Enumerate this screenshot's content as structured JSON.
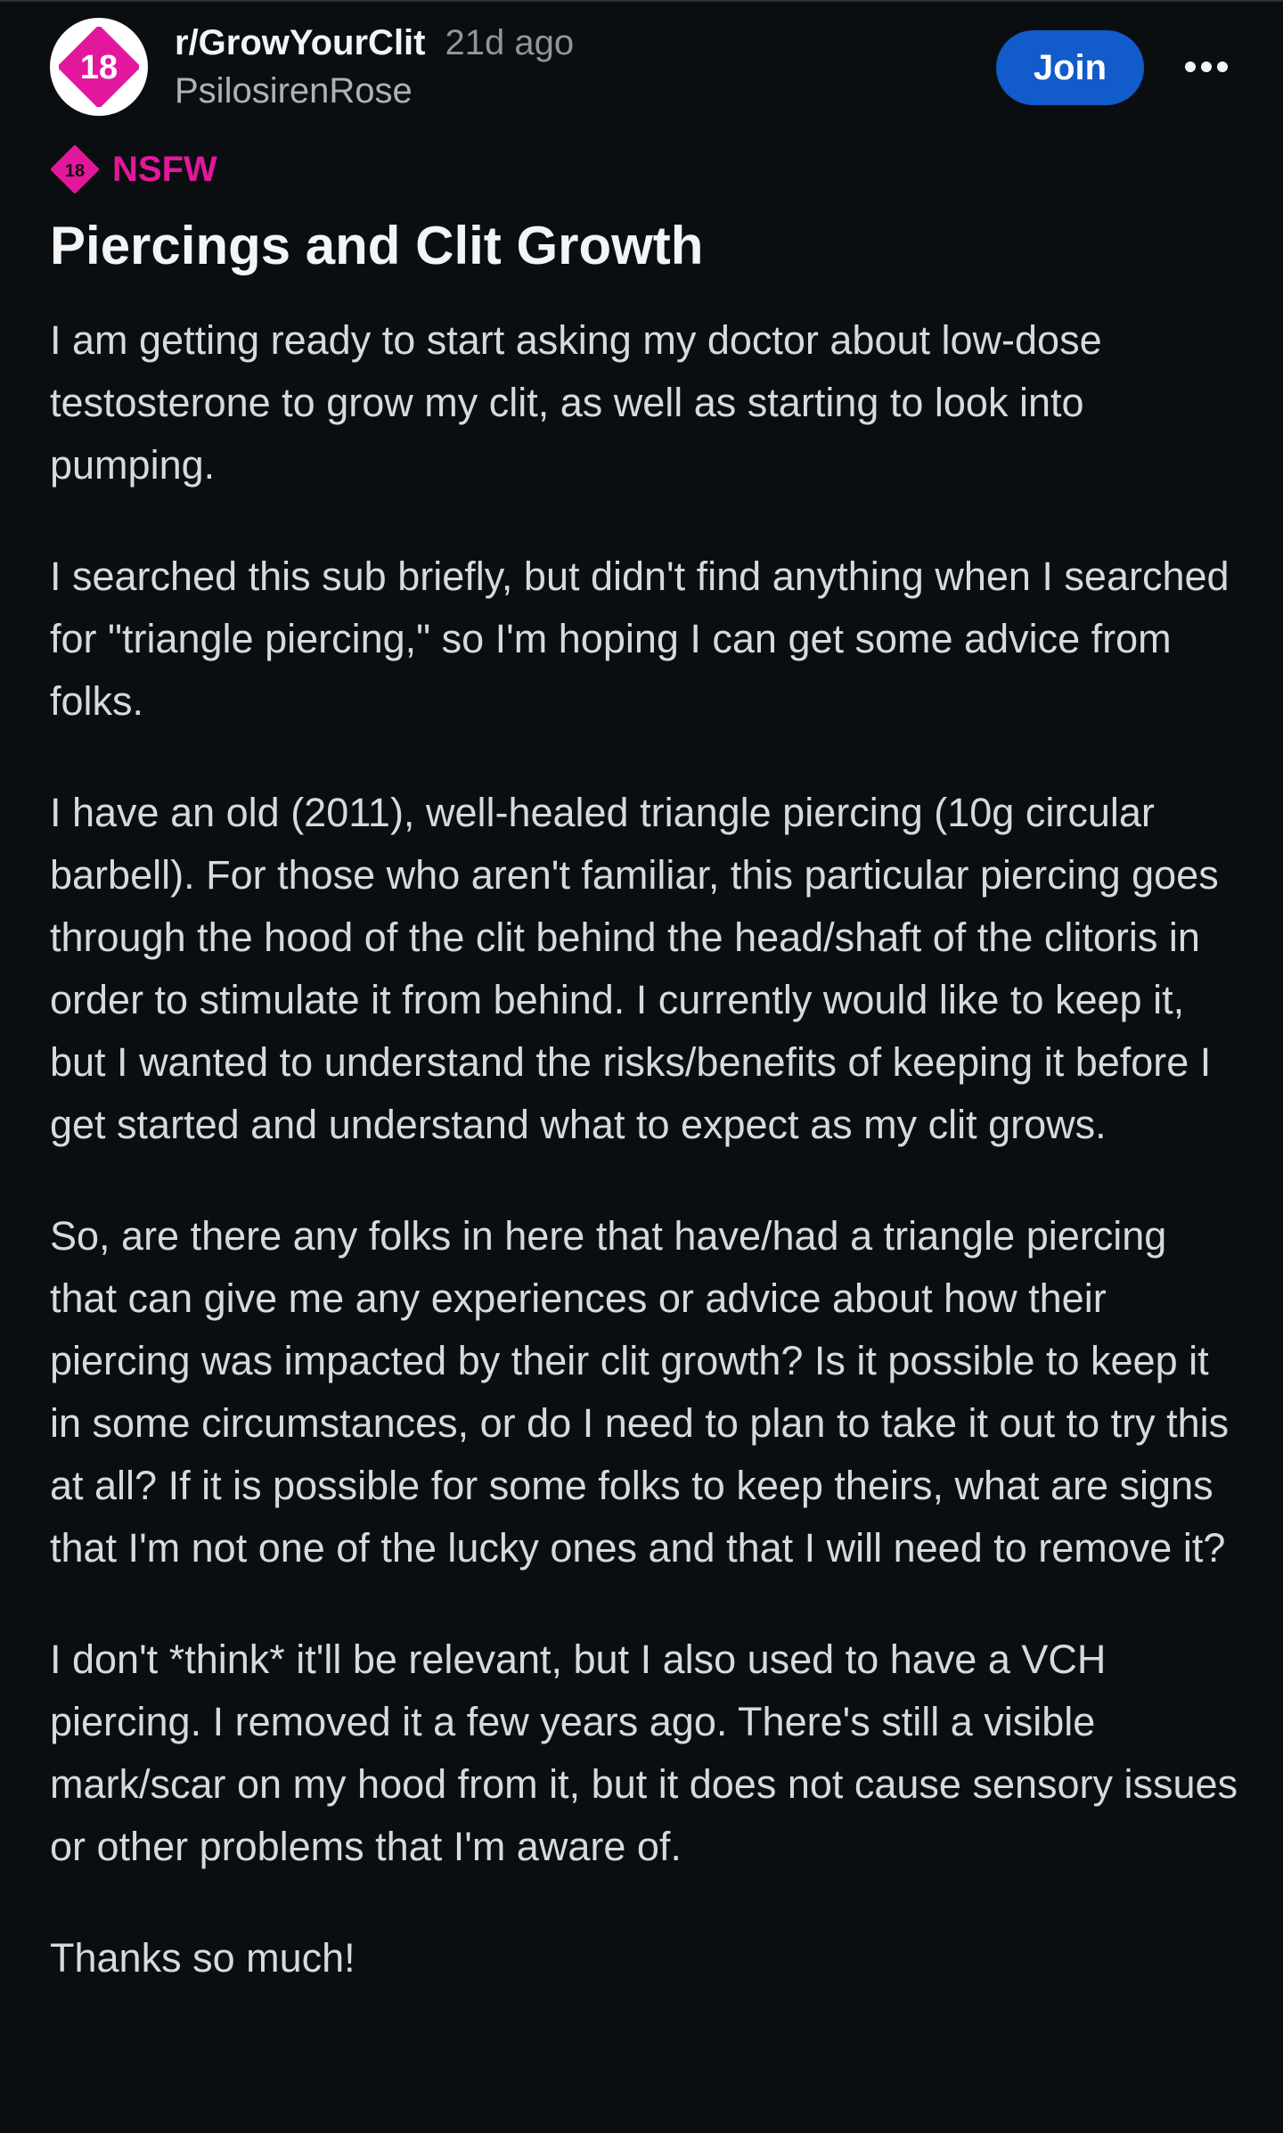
{
  "post": {
    "subreddit": "r/GrowYourClit",
    "age": "21d ago",
    "author": "PsilosirenRose",
    "avatar_badge": "18",
    "join_label": "Join",
    "more_icon": "more-horizontal-icon",
    "nsfw_badge": "18",
    "nsfw_label": "NSFW",
    "title": "Piercings and Clit Growth",
    "paragraphs": [
      "I am getting ready to start asking my doctor about low-dose testosterone to grow my clit, as well as starting to look into pumping.",
      "I searched this sub briefly, but didn't find anything when I searched for \"triangle piercing,\" so I'm hoping I can get some advice from folks.",
      "I have an old (2011), well-healed triangle piercing (10g circular barbell). For those who aren't familiar, this particular piercing goes through the hood of the clit behind the head/shaft of the clitoris in order to stimulate it from behind. I currently would like to keep it, but I wanted to understand the risks/benefits of keeping it before I get started and understand what to expect as my clit grows.",
      "So, are there any folks in here that have/had a triangle piercing that can give me any experiences or advice about how their piercing was impacted by their clit growth? Is it possible to keep it in some circumstances, or do I need to plan to take it out to try this at all? If it is possible for some folks to keep theirs, what are signs that I'm not one of the lucky ones and that I will need to remove it?",
      "I don't *think* it'll be relevant, but I also used to have a VCH piercing. I removed it a few years ago. There's still a visible mark/scar on my hood from it, but it does not cause sensory issues or other problems that I'm aware of.",
      "Thanks so much!"
    ]
  },
  "colors": {
    "background": "#0b0e10",
    "nsfw_accent": "#e3179c",
    "join_button": "#115bca",
    "body_text": "#d7dadc",
    "meta_text": "#8b979b"
  }
}
